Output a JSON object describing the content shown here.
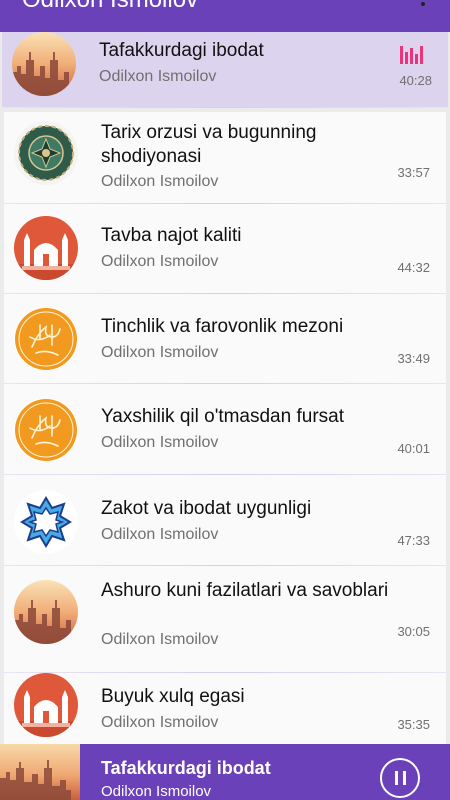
{
  "app": {
    "title": "Odilxon Ismoilov",
    "accent": "#6a41b8",
    "menu_icon": "more-vert-icon"
  },
  "tracks": [
    {
      "title": "Tafakkurdagi ibodat",
      "artist": "Odilxon Ismoilov",
      "duration": "40:28",
      "thumb": "city-sunset",
      "playing": true
    },
    {
      "title": "Tarix orzusi va bugunning shodiyonasi",
      "artist": "Odilxon Ismoilov",
      "duration": "33:57",
      "thumb": "islamic-ornament"
    },
    {
      "title": "Tavba najot kaliti",
      "artist": "Odilxon Ismoilov",
      "duration": "44:32",
      "thumb": "mosque"
    },
    {
      "title": "Tinchlik va farovonlik mezoni",
      "artist": "Odilxon Ismoilov",
      "duration": "33:49",
      "thumb": "calligraphy-seal"
    },
    {
      "title": "Yaxshilik qil o'tmasdan fursat",
      "artist": "Odilxon Ismoilov",
      "duration": "40:01",
      "thumb": "calligraphy-seal"
    },
    {
      "title": "Zakot va ibodat uygunligi",
      "artist": "Odilxon Ismoilov",
      "duration": "47:33",
      "thumb": "star-pattern"
    },
    {
      "title": "Ashuro kuni fazilatlari va savoblari",
      "artist": "Odilxon Ismoilov",
      "duration": "30:05",
      "thumb": "city-sunset"
    },
    {
      "title": "Buyuk xulq egasi",
      "artist": "Odilxon Ismoilov",
      "duration": "35:35",
      "thumb": "mosque"
    }
  ],
  "player": {
    "title": "Tafakkurdagi ibodat",
    "artist": "Odilxon Ismoilov",
    "control": "pause",
    "playing_icon": "equalizer-icon"
  }
}
